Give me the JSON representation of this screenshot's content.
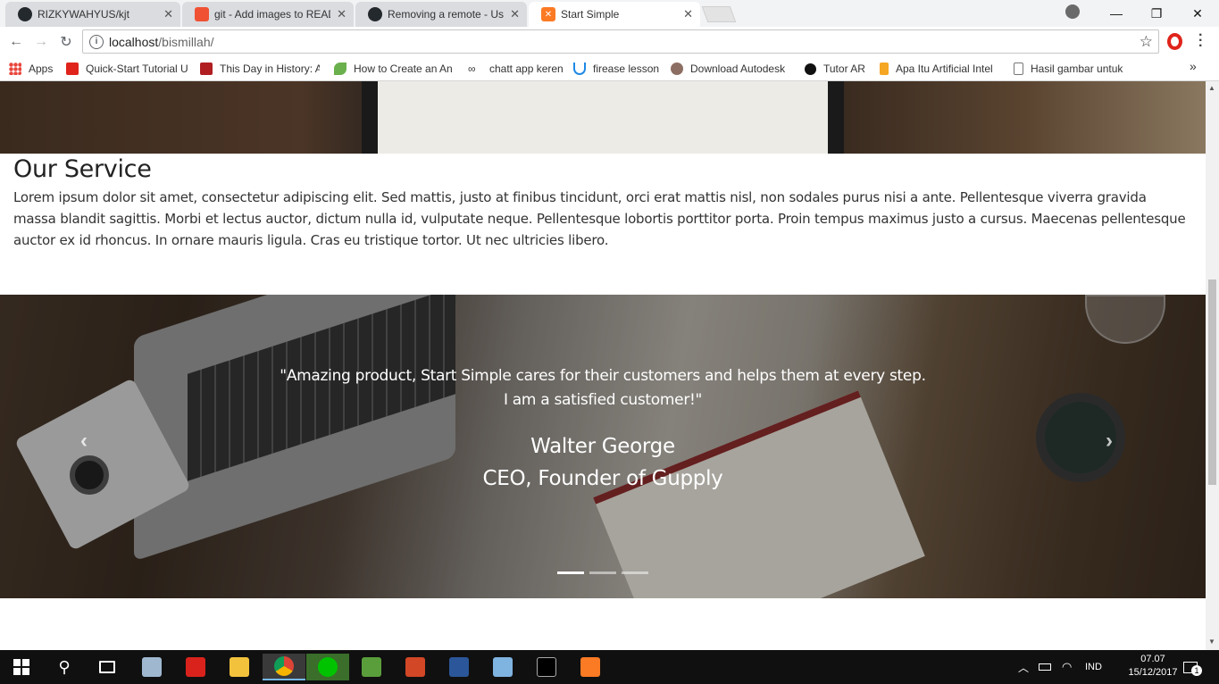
{
  "browser": {
    "tabs": [
      {
        "title": "RIZKYWAHYUS/kjt",
        "icon": "github-icon"
      },
      {
        "title": "git - Add images to READ",
        "icon": "git-icon"
      },
      {
        "title": "Removing a remote - Use",
        "icon": "github-icon"
      },
      {
        "title": "Start Simple",
        "icon": "xampp-icon",
        "active": true
      }
    ],
    "url_host": "localhost",
    "url_path": "/bismillah/",
    "bookmarks": [
      {
        "label": "Apps",
        "color": "#e8453c"
      },
      {
        "label": "Quick-Start Tutorial U",
        "color": "#e0241b"
      },
      {
        "label": "This Day in History: A",
        "color": "#b01e22"
      },
      {
        "label": "How to Create an An",
        "color": "#6ab04c"
      },
      {
        "label": "chatt app keren",
        "color": "#333333"
      },
      {
        "label": "firease lesson",
        "color": "#1e88e5"
      },
      {
        "label": "Download Autodesk",
        "color": "#8d6e63"
      },
      {
        "label": "Tutor AR",
        "color": "#111111"
      },
      {
        "label": "Apa Itu Artificial Intel",
        "color": "#f5a623"
      },
      {
        "label": "Hasil gambar untuk",
        "color": "#9e9e9e"
      }
    ]
  },
  "page": {
    "service_title": "Our Service",
    "service_body": "Lorem ipsum dolor sit amet, consectetur adipiscing elit. Sed mattis, justo at finibus tincidunt, orci erat mattis nisl, non sodales purus nisi a ante. Pellentesque viverra gravida massa blandit sagittis. Morbi et lectus auctor, dictum nulla id, vulputate neque. Pellentesque lobortis porttitor porta. Proin tempus maximus justo a cursus. Maecenas pellentesque auctor ex id rhoncus. In ornare mauris ligula. Cras eu tristique tortor. Ut nec ultricies libero.",
    "testimonial": {
      "quote_line1": "\"Amazing product, Start Simple cares for their customers and helps them at every step.",
      "quote_line2": "I am a satisfied customer!\"",
      "name": "Walter George",
      "role": "CEO, Founder of Gupply",
      "prev": "‹",
      "next": "›",
      "slide_count": 3,
      "active_slide": 1
    }
  },
  "taskbar": {
    "language": "IND",
    "time": "07.07",
    "date": "15/12/2017",
    "notifications": "1"
  }
}
